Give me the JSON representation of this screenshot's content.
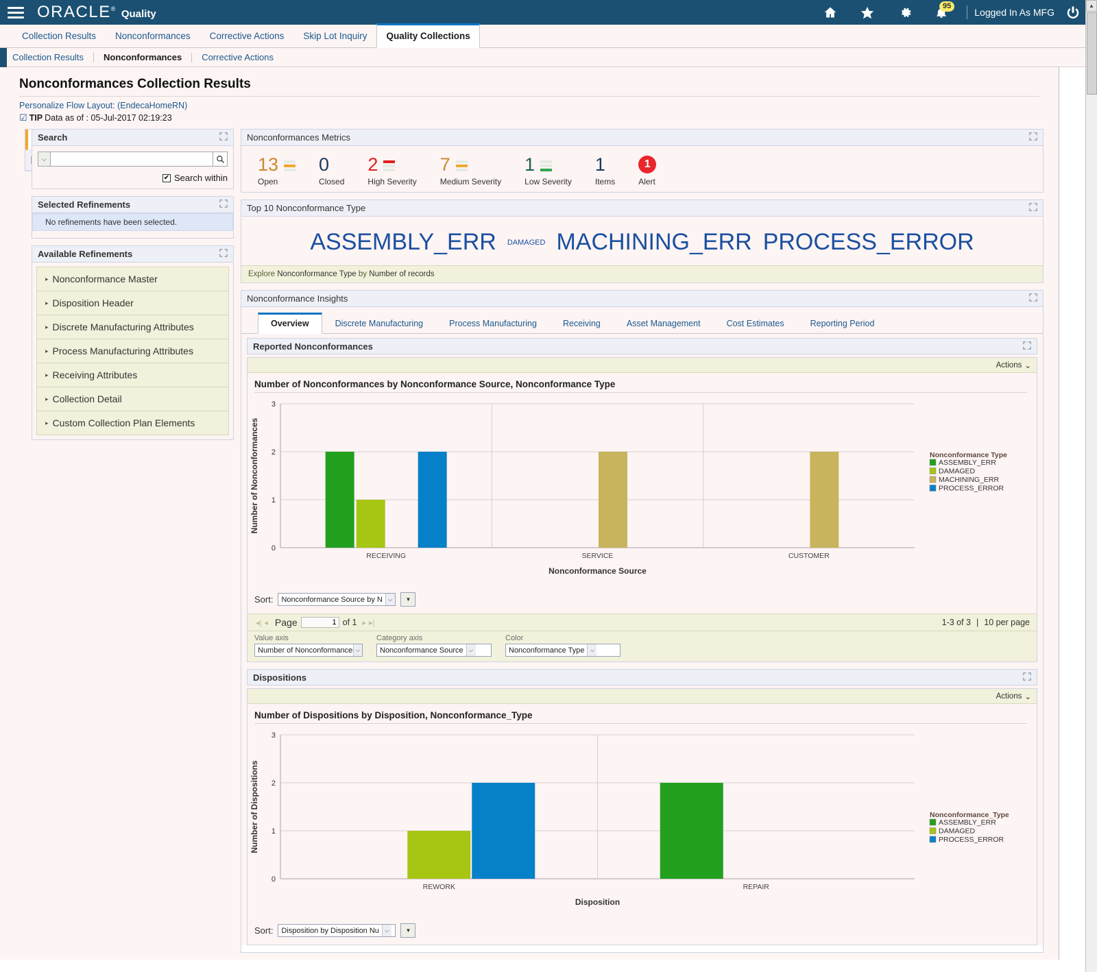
{
  "header": {
    "brand": "ORACLE",
    "brand_reg": "®",
    "app_name": "Quality",
    "menu_icon": "hamburger-icon",
    "home_icon": "home-icon",
    "favorites_icon": "star-icon",
    "settings_icon": "gear-icon",
    "notifications_icon": "bell-icon",
    "notifications_count": "95",
    "logged_in_as": "Logged In As MFG",
    "logout_icon": "power-icon"
  },
  "tabs": {
    "items": [
      {
        "label": "Collection Results",
        "active": false
      },
      {
        "label": "Nonconformances",
        "active": false
      },
      {
        "label": "Corrective Actions",
        "active": false
      },
      {
        "label": "Skip Lot Inquiry",
        "active": false
      },
      {
        "label": "Quality Collections",
        "active": true
      }
    ]
  },
  "subtabs": {
    "items": [
      {
        "label": "Collection Results",
        "active": false
      },
      {
        "label": "Nonconformances",
        "active": true
      },
      {
        "label": "Corrective Actions",
        "active": false
      }
    ]
  },
  "page": {
    "title": "Nonconformances Collection Results",
    "personalize_link": "Personalize Flow Layout: (EndecaHomeRN)",
    "tip_prefix": "TIP",
    "tip_text": "Data as of :  05-Jul-2017 02:19:23"
  },
  "rail": {
    "filter_icon": "funnel-icon",
    "bookmark_icon": "bookmark-icon"
  },
  "search": {
    "panel_title": "Search",
    "value": "",
    "placeholder": "",
    "dropdown_icon": "chevron-double-down-icon",
    "search_icon": "search-icon",
    "search_within_label": "Search within",
    "search_within_checked": true,
    "maximize_icon": "maximize-icon"
  },
  "selected_refinements": {
    "panel_title": "Selected Refinements",
    "empty_message": "No refinements have been selected.",
    "maximize_icon": "maximize-icon"
  },
  "available_refinements": {
    "panel_title": "Available Refinements",
    "maximize_icon": "maximize-icon",
    "items": [
      {
        "label": "Nonconformance Master"
      },
      {
        "label": "Disposition Header"
      },
      {
        "label": "Discrete Manufacturing Attributes"
      },
      {
        "label": "Process Manufacturing Attributes"
      },
      {
        "label": "Receiving Attributes"
      },
      {
        "label": "Collection Detail"
      },
      {
        "label": "Custom Collection Plan Elements"
      }
    ]
  },
  "metrics": {
    "panel_title": "Nonconformances Metrics",
    "maximize_icon": "maximize-icon",
    "items": [
      {
        "value": "13",
        "label": "Open",
        "value_color": "#c98a2e",
        "spark_color": "#f0a830",
        "spark_index": 1,
        "alert": false
      },
      {
        "value": "0",
        "label": "Closed",
        "value_color": "#1b3a5c",
        "spark_color": "",
        "spark_index": -1,
        "alert": false
      },
      {
        "value": "2",
        "label": "High Severity",
        "value_color": "#e02020",
        "spark_color": "#e02020",
        "spark_index": 0,
        "alert": false
      },
      {
        "value": "7",
        "label": "Medium Severity",
        "value_color": "#c98a2e",
        "spark_color": "#f0a830",
        "spark_index": 1,
        "alert": false
      },
      {
        "value": "1",
        "label": "Low Severity",
        "value_color": "#1b5e4a",
        "spark_color": "#2fa84f",
        "spark_index": 2,
        "alert": false
      },
      {
        "value": "1",
        "label": "Items",
        "value_color": "#1b3a5c",
        "spark_color": "",
        "spark_index": -1,
        "alert": false
      },
      {
        "value": "1",
        "label": "Alert",
        "value_color": "#ffffff",
        "spark_color": "",
        "spark_index": -1,
        "alert": true
      }
    ]
  },
  "tagcloud": {
    "panel_title": "Top 10 Nonconformance Type",
    "maximize_icon": "maximize-icon",
    "tags": [
      {
        "label": "ASSEMBLY_ERR",
        "size": 34
      },
      {
        "label": "DAMAGED",
        "size": 11
      },
      {
        "label": "MACHINING_ERR",
        "size": 34
      },
      {
        "label": "PROCESS_ERROR",
        "size": 34
      }
    ],
    "explore_prefix": "Explore",
    "explore_dimension": "Nonconformance Type",
    "explore_by": "by",
    "explore_metric": "Number of records"
  },
  "insights": {
    "panel_title": "Nonconformance Insights",
    "maximize_icon": "maximize-icon",
    "tabs": [
      {
        "label": "Overview",
        "active": true
      },
      {
        "label": "Discrete Manufacturing",
        "active": false
      },
      {
        "label": "Process Manufacturing",
        "active": false
      },
      {
        "label": "Receiving",
        "active": false
      },
      {
        "label": "Asset Management",
        "active": false
      },
      {
        "label": "Cost Estimates",
        "active": false
      },
      {
        "label": "Reporting Period",
        "active": false
      }
    ]
  },
  "reported": {
    "panel_title": "Reported Nonconformances",
    "maximize_icon": "maximize-icon",
    "actions_label": "Actions",
    "actions_icon": "chevron-down-icon",
    "sort_label": "Sort:",
    "sort_value": "Nonconformance Source by N",
    "sort_button_icon": "triangle-down-icon",
    "pagination": {
      "page_label": "Page",
      "page_value": "1",
      "of_label": "of 1",
      "range": "1-3 of 3",
      "per_page": "10 per page",
      "first_icon": "first-page-icon",
      "prev_icon": "prev-page-icon",
      "next_icon": "next-page-icon",
      "last_icon": "last-page-icon"
    },
    "axis_controls": [
      {
        "label": "Value axis",
        "value": "Number of Nonconformances"
      },
      {
        "label": "Category axis",
        "value": "Nonconformance Source"
      },
      {
        "label": "Color",
        "value": "Nonconformance Type"
      }
    ]
  },
  "dispositions": {
    "panel_title": "Dispositions",
    "maximize_icon": "maximize-icon",
    "actions_label": "Actions",
    "actions_icon": "chevron-down-icon",
    "sort_label": "Sort:",
    "sort_value": "Disposition by Disposition Nu",
    "sort_button_icon": "triangle-down-icon"
  },
  "chart_data": [
    {
      "type": "bar",
      "id": "reported-nonconformances-chart",
      "title": "Number of Nonconformances by Nonconformance Source, Nonconformance Type",
      "xlabel": "Nonconformance Source",
      "ylabel": "Number of Nonconformances",
      "categories": [
        "RECEIVING",
        "SERVICE",
        "CUSTOMER"
      ],
      "ylim": [
        0,
        3
      ],
      "yticks": [
        0,
        1,
        2,
        3
      ],
      "grid": true,
      "legend_title": "Nonconformance Type",
      "legend_position": "right",
      "series": [
        {
          "name": "ASSEMBLY_ERR",
          "color": "#22a01e",
          "values": [
            2,
            0,
            0
          ]
        },
        {
          "name": "DAMAGED",
          "color": "#a6c613",
          "values": [
            1,
            0,
            0
          ]
        },
        {
          "name": "MACHINING_ERR",
          "color": "#c8b45c",
          "values": [
            0,
            2,
            2
          ]
        },
        {
          "name": "PROCESS_ERROR",
          "color": "#0680c8",
          "values": [
            2,
            0,
            0
          ]
        }
      ]
    },
    {
      "type": "bar",
      "id": "dispositions-chart",
      "title": "Number of Dispositions by Disposition, Nonconformance_Type",
      "xlabel": "Disposition",
      "ylabel": "Number of Dispositions",
      "categories": [
        "REWORK",
        "REPAIR"
      ],
      "ylim": [
        0,
        3
      ],
      "yticks": [
        0,
        1,
        2,
        3
      ],
      "grid": true,
      "legend_title": "Nonconformance_Type",
      "legend_position": "right",
      "series": [
        {
          "name": "ASSEMBLY_ERR",
          "color": "#22a01e",
          "values": [
            0,
            2
          ]
        },
        {
          "name": "DAMAGED",
          "color": "#a6c613",
          "values": [
            1,
            0
          ]
        },
        {
          "name": "PROCESS_ERROR",
          "color": "#0680c8",
          "values": [
            2,
            0
          ]
        }
      ]
    }
  ]
}
